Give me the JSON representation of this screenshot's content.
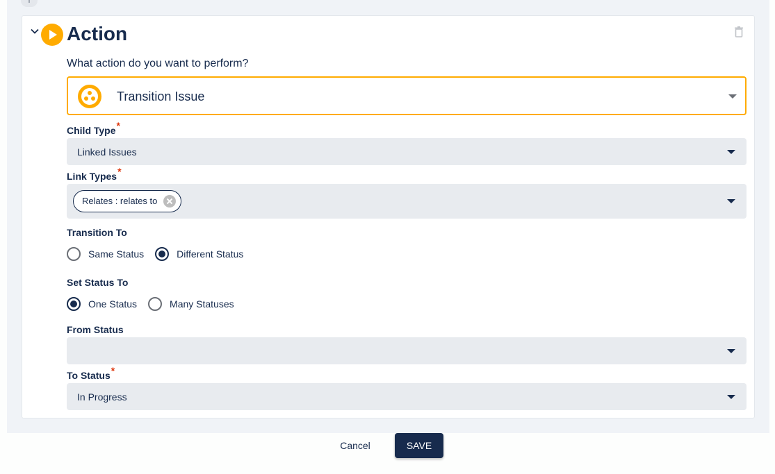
{
  "section": {
    "title": "Action",
    "icon": "play-circle-icon",
    "collapse_icon": "chevron-down-icon",
    "delete_icon": "trash-icon"
  },
  "action_question": "What action do you want to perform?",
  "action_select": {
    "value": "Transition Issue",
    "icon": "transition-issue-icon",
    "accent_color": "#ffab00"
  },
  "fields": {
    "child_type": {
      "label": "Child Type",
      "required": "*",
      "value": "Linked Issues"
    },
    "link_types": {
      "label": "Link Types",
      "required": "*",
      "chips": [
        "Relates : relates to"
      ]
    },
    "transition_to": {
      "label": "Transition To",
      "options": [
        {
          "label": "Same Status",
          "checked": false
        },
        {
          "label": "Different Status",
          "checked": true
        }
      ]
    },
    "set_status_to": {
      "label": "Set Status To",
      "options": [
        {
          "label": "One Status",
          "checked": true
        },
        {
          "label": "Many Statuses",
          "checked": false
        }
      ]
    },
    "from_status": {
      "label": "From Status",
      "value": ""
    },
    "to_status": {
      "label": "To Status",
      "required": "*",
      "value": "In Progress"
    }
  },
  "footer": {
    "cancel_label": "Cancel",
    "save_label": "SAVE"
  },
  "colors": {
    "primary": "#172b4d",
    "accent": "#ffab00",
    "required": "#de350b",
    "field_bg": "#e8ebef"
  }
}
